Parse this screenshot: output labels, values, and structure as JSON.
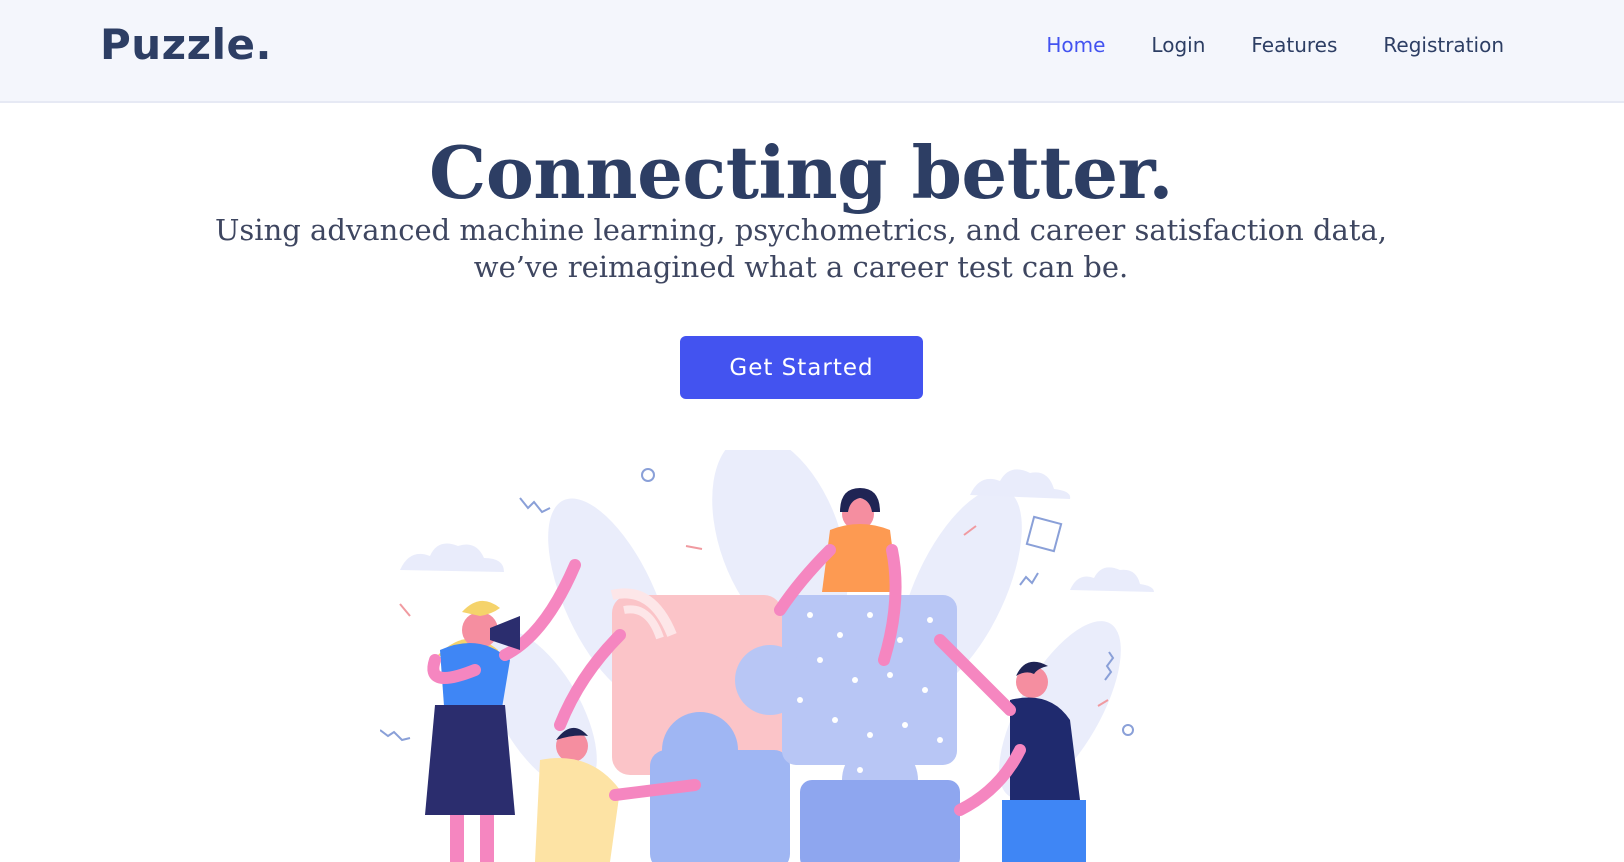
{
  "brand": {
    "logo": "Puzzle."
  },
  "nav": {
    "items": [
      {
        "label": "Home",
        "active": true
      },
      {
        "label": "Login",
        "active": false
      },
      {
        "label": "Features",
        "active": false
      },
      {
        "label": "Registration",
        "active": false
      }
    ]
  },
  "hero": {
    "title": "Connecting better.",
    "subtitle_line1": "Using advanced machine learning, psychometrics, and career satisfaction data,",
    "subtitle_line2": "we’ve reimagined what a career test can be.",
    "cta_label": "Get Started"
  },
  "colors": {
    "accent": "#4353f0",
    "text_dark": "#2d3e64",
    "header_bg": "#f4f6fc"
  },
  "icons": {
    "illustration": "team-puzzle-illustration"
  }
}
